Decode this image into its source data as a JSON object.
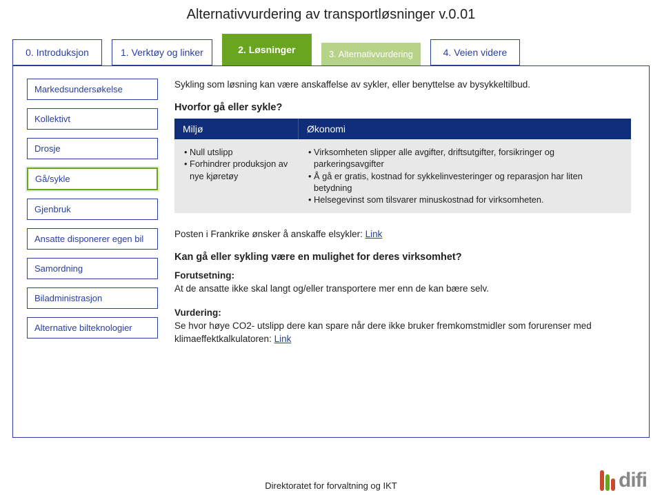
{
  "title": "Alternativvurdering av transportløsninger v.0.01",
  "tabs": {
    "t0": "0. Introduksjon",
    "t1": "1. Verktøy og linker",
    "t2": "2. Løsninger",
    "t3": "3. Alternativvurdering",
    "t4": "4. Veien videre"
  },
  "sidebar": {
    "s0": "Markedsundersøkelse",
    "s1": "Kollektivt",
    "s2": "Drosje",
    "s3": "Gå/sykle",
    "s4": "Gjenbruk",
    "s5": "Ansatte disponerer egen bil",
    "s6": "Samordning",
    "s7": "Biladministrasjon",
    "s8": "Alternative bilteknologier"
  },
  "main": {
    "intro": "Sykling som løsning kan være anskaffelse av sykler, eller benyttelse av bysykkeltilbud.",
    "q1": "Hvorfor gå eller sykle?",
    "th_miljo": "Miljø",
    "th_okonomi": "Økonomi",
    "miljo_b1": "• Null utslipp",
    "miljo_b2": "• Forhindrer produksjon av nye kjøretøy",
    "oko_b1": "• Virksomheten slipper alle avgifter, driftsutgifter, forsikringer og parkeringsavgifter",
    "oko_b2": "• Å gå er gratis, kostnad for sykkelinvesteringer og reparasjon har liten betydning",
    "oko_b3": "• Helsegevinst som tilsvarer minuskostnad for virksomheten.",
    "posten": "Posten i Frankrike ønsker å anskaffe elsykler: ",
    "link_label": "Link",
    "q2": "Kan gå eller sykling være en mulighet for deres virksomhet?",
    "forut_label": "Forutsetning:",
    "forut_text": "At de ansatte ikke skal langt og/eller transportere mer enn de kan bære selv.",
    "vurd_label": "Vurdering:",
    "vurd_text": "Se hvor høye CO2- utslipp dere kan spare når dere ikke bruker fremkomstmidler som forurenser med klimaeffektkalkulatoren: "
  },
  "footer": "Direktoratet for forvaltning og IKT",
  "logo": "difi"
}
